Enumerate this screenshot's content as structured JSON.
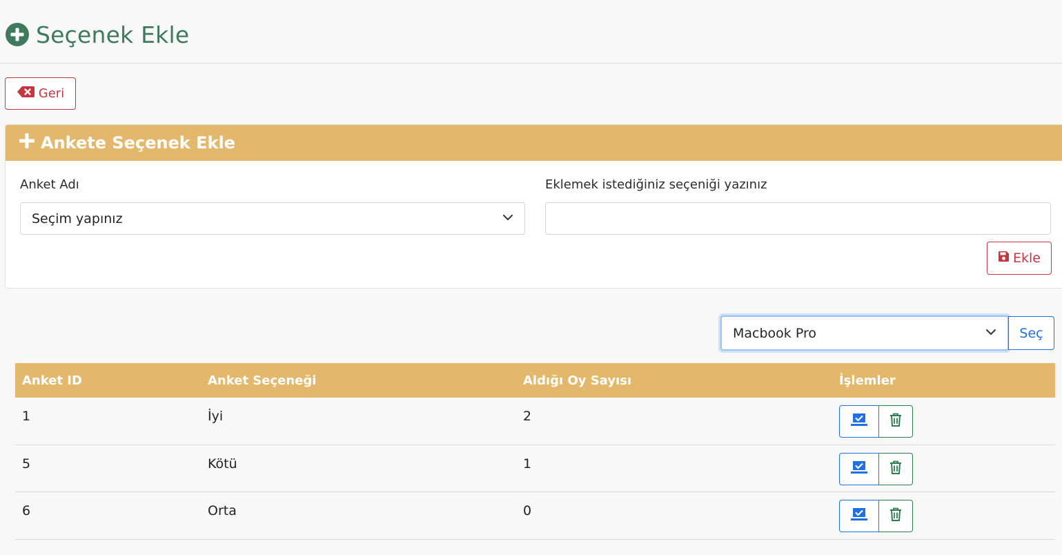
{
  "page": {
    "title": "Seçenek Ekle",
    "title_icon": "plus-circle-icon",
    "title_color": "#3f7a5c"
  },
  "back_button": {
    "label": "Geri",
    "icon": "backspace-icon",
    "color": "#c9353f"
  },
  "card": {
    "title": "Ankete Seçenek Ekle",
    "header_icon": "plus-icon",
    "header_color": "#e4b86b",
    "survey_label": "Anket Adı",
    "survey_select_value": "Seçim yapınız",
    "option_label": "Eklemek istediğiniz seçeniği yazınız",
    "option_value": "",
    "add_button_label": "Ekle",
    "add_button_icon": "save-icon"
  },
  "filter": {
    "select_value": "Macbook Pro",
    "button_label": "Seç",
    "accent_color": "#1f6fe5"
  },
  "table": {
    "columns": [
      "Anket ID",
      "Anket Seçeneği",
      "Aldığı Oy Sayısı",
      "İşlemler"
    ],
    "rows": [
      {
        "id": "1",
        "option": "İyi",
        "votes": "2"
      },
      {
        "id": "5",
        "option": "Kötü",
        "votes": "1"
      },
      {
        "id": "6",
        "option": "Orta",
        "votes": "0"
      }
    ],
    "action_icons": [
      "edit-icon",
      "trash-icon"
    ]
  }
}
